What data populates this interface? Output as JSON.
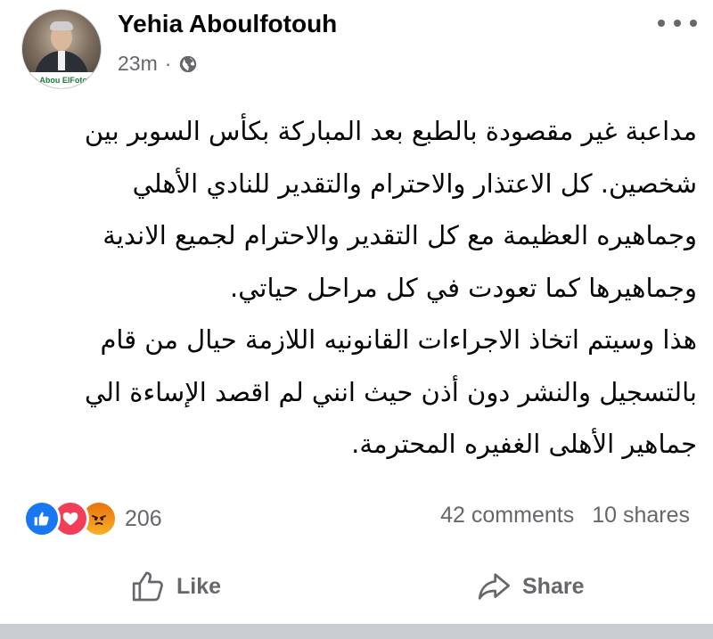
{
  "post": {
    "author": "Yehia Aboulfotouh",
    "time": "23m",
    "separator": "·",
    "avatar_caption": "ia Abou ElFotoh",
    "privacy_icon": "globe-icon",
    "more_icon": "more-dots-icon",
    "body_lines": [
      "مداعبة غير مقصودة بالطبع بعد المباركة بكأس السوبر بين",
      "شخصين. كل الاعتذار والاحترام والتقدير للنادي الأهلي",
      "وجماهيره العظيمة مع كل التقدير والاحترام لجميع الاندية",
      "وجماهيرها كما تعودت في كل مراحل حياتي.",
      "هذا وسيتم اتخاذ الاجراءات القانونيه اللازمة حيال من قام",
      "بالتسجيل والنشر دون أذن حيث انني لم اقصد الإساءة الي",
      "جماهير الأهلى الغفيره المحترمة."
    ]
  },
  "engagement": {
    "reaction_icons": [
      "like-reaction-icon",
      "love-reaction-icon",
      "angry-reaction-icon"
    ],
    "reaction_count": "206",
    "comments": "42 comments",
    "shares": "10 shares"
  },
  "actions": {
    "like_label": "Like",
    "share_label": "Share"
  },
  "colors": {
    "secondary_text": "#65676b",
    "like_blue": "#1877f2",
    "love_red": "#f33e58",
    "angry_orange": "#e9710f"
  }
}
